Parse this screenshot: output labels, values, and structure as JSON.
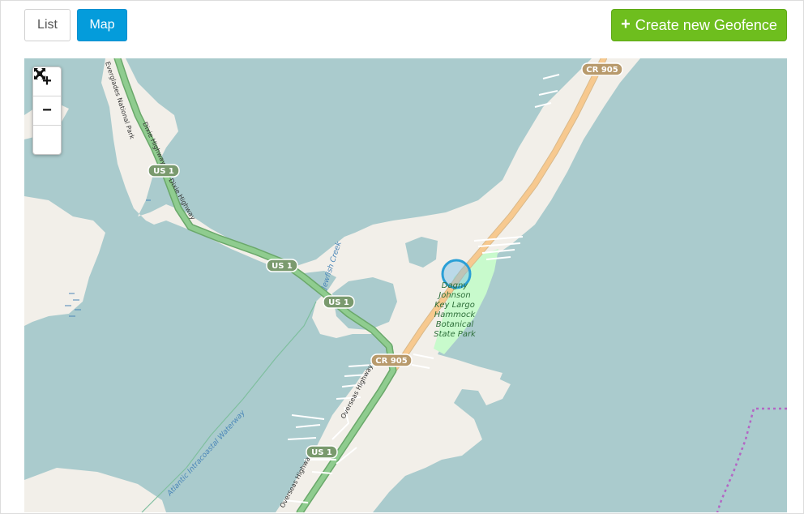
{
  "toolbar": {
    "list_label": "List",
    "map_label": "Map",
    "create_label": "Create new Geofence",
    "create_icon": "plus-icon"
  },
  "map": {
    "controls": {
      "zoom_in": "+",
      "zoom_out": "−",
      "fullscreen_icon": "fullscreen-icon"
    },
    "labels": {
      "park_name": "Everglades National Park",
      "dixie_highway_1": "Dixie Highway",
      "dixie_highway_2": "Dixie Highway",
      "overseas_highway_1": "Overseas Highway",
      "overseas_highway_2": "Overseas Highway",
      "intracoastal": "Atlantic Intracoastal Waterway",
      "jewfish_creek": "Jewfish Creek",
      "botanical_park_1": "Dagny",
      "botanical_park_2": "Johnson",
      "botanical_park_3": "Key Largo",
      "botanical_park_4": "Hammock",
      "botanical_park_5": "Botanical",
      "botanical_park_6": "State Park"
    },
    "shields": {
      "us1_a": "US 1",
      "us1_b": "US 1",
      "us1_c": "US 1",
      "us1_d": "US 1",
      "cr905_a": "CR 905",
      "cr905_b": "CR 905"
    },
    "colors": {
      "water": "#aacbcd",
      "land": "#f2efe9",
      "park": "#c8facc",
      "motorway": "#8fcc8f",
      "secondary": "#f7c98f",
      "geofence": "#2a9fd6",
      "boundary": "#b366c4"
    }
  }
}
